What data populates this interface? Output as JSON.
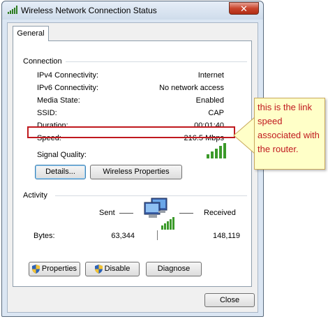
{
  "window": {
    "title": "Wireless Network Connection Status",
    "close_glyph": "✕",
    "tab": "General"
  },
  "connection": {
    "heading": "Connection",
    "rows": [
      {
        "label": "IPv4 Connectivity:",
        "value": "Internet"
      },
      {
        "label": "IPv6 Connectivity:",
        "value": "No network access"
      },
      {
        "label": "Media State:",
        "value": "Enabled"
      },
      {
        "label": "SSID:",
        "value": "CAP"
      },
      {
        "label": "Duration:",
        "value": "00:01:40"
      },
      {
        "label": "Speed:",
        "value": "216.5 Mbps"
      }
    ],
    "signal_label": "Signal Quality:",
    "signal_bars": 5,
    "details_button": "Details...",
    "wireless_props_button": "Wireless Properties"
  },
  "activity": {
    "heading": "Activity",
    "sent_label": "Sent",
    "received_label": "Received",
    "bytes_label": "Bytes:",
    "bytes_sent": "63,344",
    "bytes_received": "148,119"
  },
  "bottom_buttons": {
    "properties": "Properties",
    "disable": "Disable",
    "diagnose": "Diagnose"
  },
  "footer": {
    "close_button": "Close"
  },
  "annotation": {
    "text": "this is the link speed associated with the router.",
    "color": "#c0181e"
  }
}
